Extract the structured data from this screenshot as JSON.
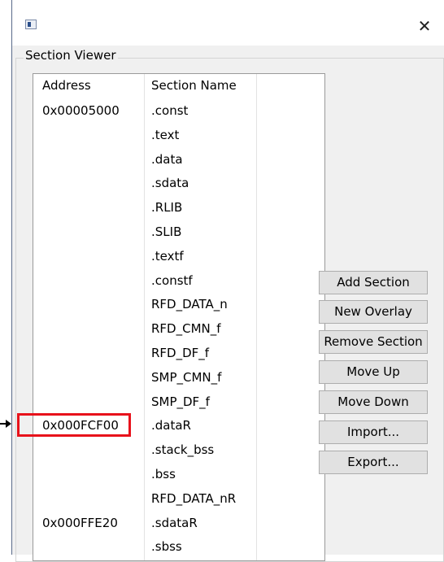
{
  "window": {
    "title": ""
  },
  "group": {
    "label": "Section Viewer"
  },
  "table": {
    "headers": {
      "address": "Address",
      "section_name": "Section Name"
    },
    "rows": [
      {
        "address": "0x00005000",
        "name": ".const"
      },
      {
        "address": "",
        "name": ".text"
      },
      {
        "address": "",
        "name": ".data"
      },
      {
        "address": "",
        "name": ".sdata"
      },
      {
        "address": "",
        "name": ".RLIB"
      },
      {
        "address": "",
        "name": ".SLIB"
      },
      {
        "address": "",
        "name": ".textf"
      },
      {
        "address": "",
        "name": ".constf"
      },
      {
        "address": "",
        "name": "RFD_DATA_n"
      },
      {
        "address": "",
        "name": "RFD_CMN_f"
      },
      {
        "address": "",
        "name": "RFD_DF_f"
      },
      {
        "address": "",
        "name": "SMP_CMN_f"
      },
      {
        "address": "",
        "name": "SMP_DF_f"
      },
      {
        "address": "0x000FCF00",
        "name": ".dataR"
      },
      {
        "address": "",
        "name": ".stack_bss"
      },
      {
        "address": "",
        "name": ".bss"
      },
      {
        "address": "",
        "name": "RFD_DATA_nR"
      },
      {
        "address": "0x000FFE20",
        "name": ".sdataR"
      },
      {
        "address": "",
        "name": ".sbss"
      }
    ]
  },
  "buttons": {
    "add_section": "Add Section",
    "new_overlay": "New Overlay",
    "remove_section": "Remove Section",
    "move_up": "Move Up",
    "move_down": "Move Down",
    "import": "Import...",
    "export": "Export..."
  },
  "icons": {
    "app": "app-window-icon",
    "close": "close-icon",
    "pointer": "arrow-right-icon"
  },
  "colors": {
    "highlight": "#e8121b"
  }
}
